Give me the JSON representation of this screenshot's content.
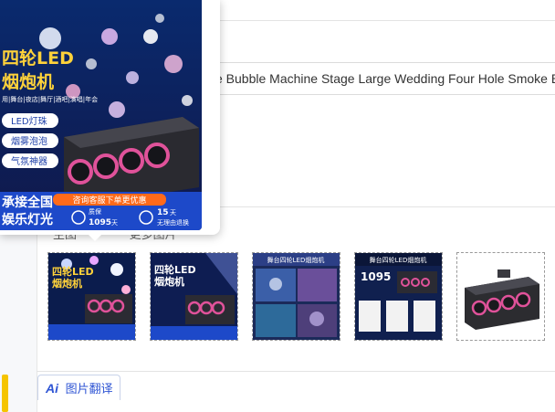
{
  "product": {
    "title_text": "e Bubble Machine Stage Large Wedding Four Hole Smoke B"
  },
  "gallery": {
    "tabs": [
      {
        "label": "主图"
      },
      {
        "label": "更多图片"
      }
    ],
    "thumbnails": [
      {
        "name": "thumbnail-1"
      },
      {
        "name": "thumbnail-2"
      },
      {
        "name": "thumbnail-3"
      },
      {
        "name": "thumbnail-4"
      },
      {
        "name": "thumbnail-5"
      }
    ]
  },
  "image_translate": {
    "icon_text": "Ai",
    "label": "图片翻译"
  },
  "preview": {
    "headline_1": "四轮LED",
    "headline_2": "烟炮机",
    "usage_line": "用|舞台|夜店|舞厅|酒吧|演唱|年会",
    "features": [
      "LED灯珠",
      "烟雾泡泡",
      "气氛神器"
    ],
    "bottom_left_1": "承接全国",
    "bottom_left_2": "娱乐灯光",
    "contact_banner": "咨询客服下单更优惠",
    "warranty_label": "质保",
    "warranty_value": "1095",
    "warranty_unit": "天",
    "return_value": "15",
    "return_unit": "天",
    "return_label": "无理由退换"
  },
  "thumb_text": {
    "t1_line1": "四轮LED",
    "t1_line2": "烟炮机",
    "t2_line1": "四轮LED",
    "t2_line2": "烟炮机",
    "t3_title": "舞台四轮LED烟炮机",
    "t4_title": "舞台四轮LED烟炮机",
    "t4_number": "1095"
  },
  "colors": {
    "brand_blue": "#2f55d4",
    "accent_yellow": "#f5c400",
    "bubble_pink": "#e0529a"
  }
}
